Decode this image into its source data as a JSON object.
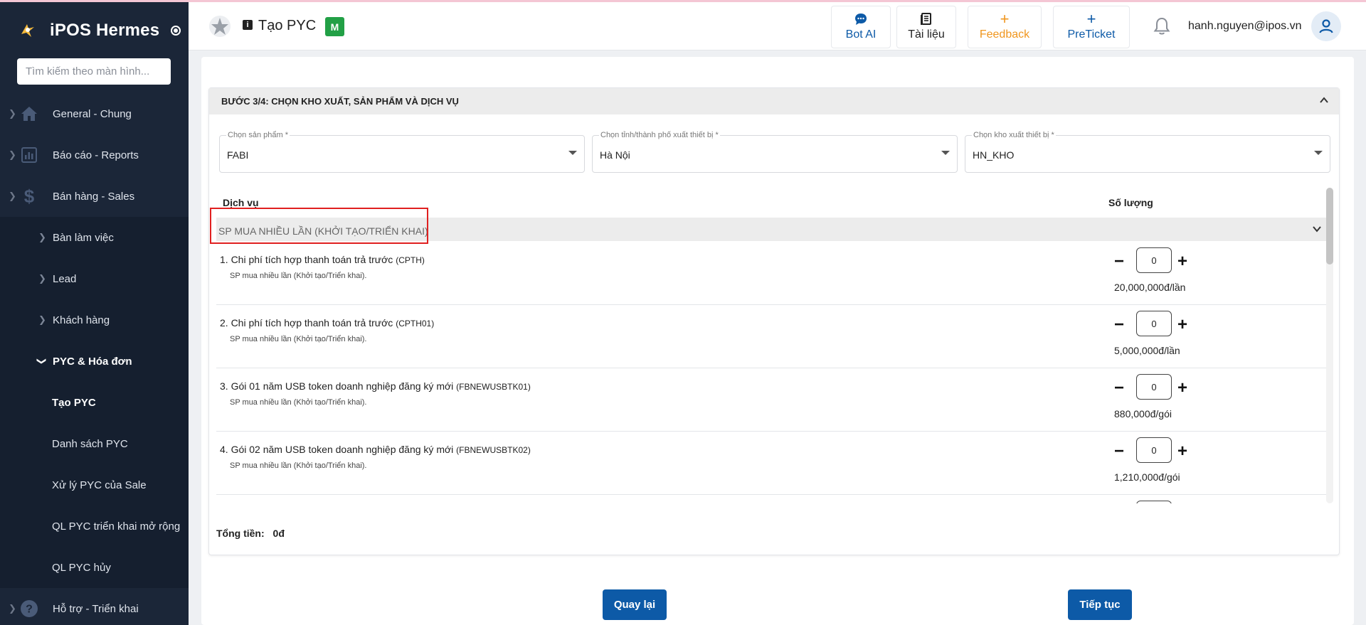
{
  "app": {
    "name": "iPOS Hermes",
    "search_placeholder": "Tìm kiếm theo màn hình..."
  },
  "sidebar": {
    "top_items": [
      {
        "label": "General - Chung",
        "icon": "home-icon"
      },
      {
        "label": "Báo cáo - Reports",
        "icon": "report-chart-icon"
      },
      {
        "label": "Bán hàng - Sales",
        "icon": "dollar-icon"
      }
    ],
    "sales_sub": [
      {
        "label": "Bàn làm việc"
      },
      {
        "label": "Lead"
      },
      {
        "label": "Khách hàng"
      },
      {
        "label": "PYC & Hóa đơn"
      }
    ],
    "pyc_leaves": [
      {
        "label": "Tạo PYC",
        "active": true
      },
      {
        "label": "Danh sách PYC"
      },
      {
        "label": "Xử lý PYC của Sale"
      },
      {
        "label": "QL PYC triển khai mở rộng"
      },
      {
        "label": "QL PYC hủy"
      }
    ],
    "bottom_item": {
      "label": "Hỗ trợ - Triển khai",
      "icon": "help-icon"
    }
  },
  "header": {
    "title": "Tạo PYC",
    "badge": "M",
    "buttons": {
      "bot_ai": "Bot AI",
      "tai_lieu": "Tài liệu",
      "feedback": "Feedback",
      "preticket": "PreTicket"
    },
    "user": "hanh.nguyen@ipos.vn"
  },
  "step": {
    "title": "BƯỚC 3/4: CHỌN KHO XUẤT, SẢN PHẨM VÀ DỊCH VỤ"
  },
  "filters": {
    "product": {
      "label": "Chọn sản phẩm *",
      "value": "FABI"
    },
    "province": {
      "label": "Chọn tỉnh/thành phố xuất thiết bị *",
      "value": "Hà Nội"
    },
    "warehouse": {
      "label": "Chọn kho xuất thiết bị *",
      "value": "HN_KHO"
    }
  },
  "columns": {
    "service": "Dịch vụ",
    "quantity": "Số lượng"
  },
  "group": {
    "label": "SP MUA NHIỀU LẦN (KHỞI TẠO/TRIỂN KHAI)"
  },
  "items": [
    {
      "name": "1. Chi phí tích hợp thanh toán trả trước",
      "code": "(CPTH)",
      "desc": "SP mua nhiều lần (Khởi tạo/Triển khai).",
      "qty": "0",
      "price": "20,000,000đ/lần"
    },
    {
      "name": "2. Chi phí tích hợp thanh toán trả trước",
      "code": "(CPTH01)",
      "desc": "SP mua nhiều lần (Khởi tạo/Triển khai).",
      "qty": "0",
      "price": "5,000,000đ/lần"
    },
    {
      "name": "3. Gói 01 năm USB token doanh nghiệp đăng ký mới",
      "code": "(FBNEWUSBTK01)",
      "desc": "SP mua nhiều lần (Khởi tạo/Triển khai).",
      "qty": "0",
      "price": "880,000đ/gói"
    },
    {
      "name": "4. Gói 02 năm USB token doanh nghiệp đăng ký mới",
      "code": "(FBNEWUSBTK02)",
      "desc": "SP mua nhiều lần (Khởi tạo/Triển khai).",
      "qty": "0",
      "price": "1,210,000đ/gói"
    }
  ],
  "total": {
    "label": "Tổng tiền:",
    "value": "0đ"
  },
  "actions": {
    "back": "Quay lại",
    "next": "Tiếp tục"
  },
  "colors": {
    "sidebar_bg": "#1b2638",
    "primary": "#0d5aa7",
    "feedback": "#f0961e",
    "highlight_border": "#e02020",
    "badge": "#22a046"
  }
}
